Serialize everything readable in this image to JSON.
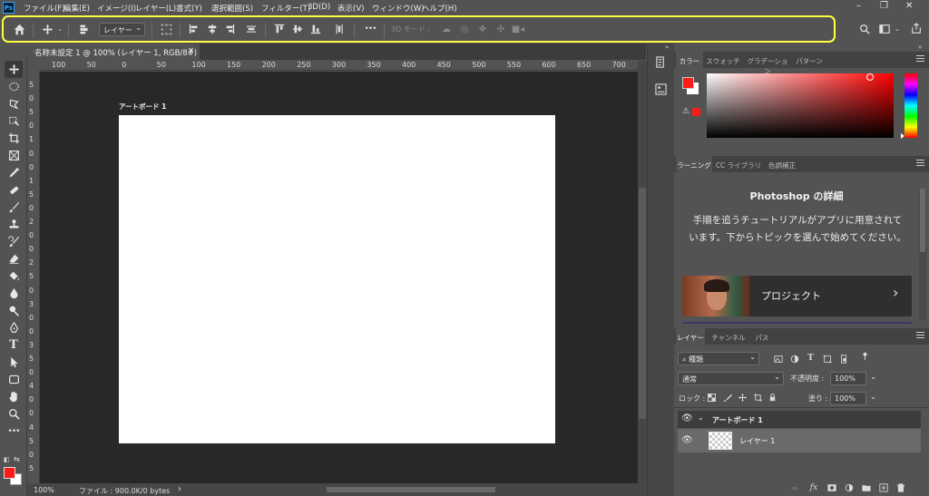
{
  "app": {
    "logo_text": "Ps",
    "brand_color": "#31a8ff"
  },
  "menubar": {
    "items": [
      "ファイル(F)",
      "編集(E)",
      "イメージ(I)",
      "レイヤー(L)",
      "書式(Y)",
      "選択範囲(S)",
      "フィルター(T)",
      "3D(D)",
      "表示(V)",
      "ウィンドウ(W)",
      "ヘルプ(H)"
    ],
    "window_controls": [
      "–",
      "❐",
      "✕"
    ]
  },
  "options_bar": {
    "highlight_color": "#ffff41",
    "auto_select_value": "レイヤー",
    "mode_3d_label": "3D モード :",
    "more_label": "•••"
  },
  "document": {
    "tab_title": "名称未設定 1 @ 100% (レイヤー 1, RGB/8#)",
    "tab_close": "×",
    "artboard_label": "アートボード 1",
    "zoom": "100%",
    "file_info": "ファイル : 900.0K/0 bytes",
    "status_arrow": "›"
  },
  "rulers": {
    "horizontal": [
      "100",
      "50",
      "0",
      "50",
      "100",
      "150",
      "200",
      "250",
      "300",
      "350",
      "400",
      "450",
      "500",
      "550",
      "600",
      "650",
      "700"
    ],
    "vertical": [
      "5",
      "0",
      "5",
      "0",
      "1",
      "0",
      "0",
      "1",
      "5",
      "0",
      "2",
      "0",
      "0",
      "2",
      "5",
      "0",
      "3",
      "0",
      "0",
      "3",
      "5",
      "0",
      "4",
      "0",
      "0",
      "4",
      "5",
      "0",
      "5"
    ]
  },
  "color_panel": {
    "tabs": [
      "カラー",
      "スウォッチ",
      "グラデーション",
      "パターン"
    ],
    "foreground": "#ff1a1a",
    "background": "#ffffff",
    "hue": "#ff0000"
  },
  "learn_panel": {
    "tabs": [
      "ラーニング",
      "CC ライブラリ",
      "色調補正"
    ],
    "title": "Photoshop の詳細",
    "description": "手順を追うチュートリアルがアプリに用意されています。下からトピックを選んで始めてください。",
    "card_label": "プロジェクト",
    "card_arrow": "›"
  },
  "layers_panel": {
    "tabs": [
      "レイヤー",
      "チャンネル",
      "パス"
    ],
    "filter_kind": "種類",
    "blend_mode": "通常",
    "opacity_label": "不透明度 :",
    "opacity_value": "100%",
    "lock_label": "ロック :",
    "fill_label": "塗り :",
    "fill_value": "100%",
    "layers": [
      {
        "name": "アートボード 1",
        "type": "artboard",
        "expanded": true
      },
      {
        "name": "レイヤー 1",
        "type": "layer",
        "selected": true
      }
    ]
  }
}
